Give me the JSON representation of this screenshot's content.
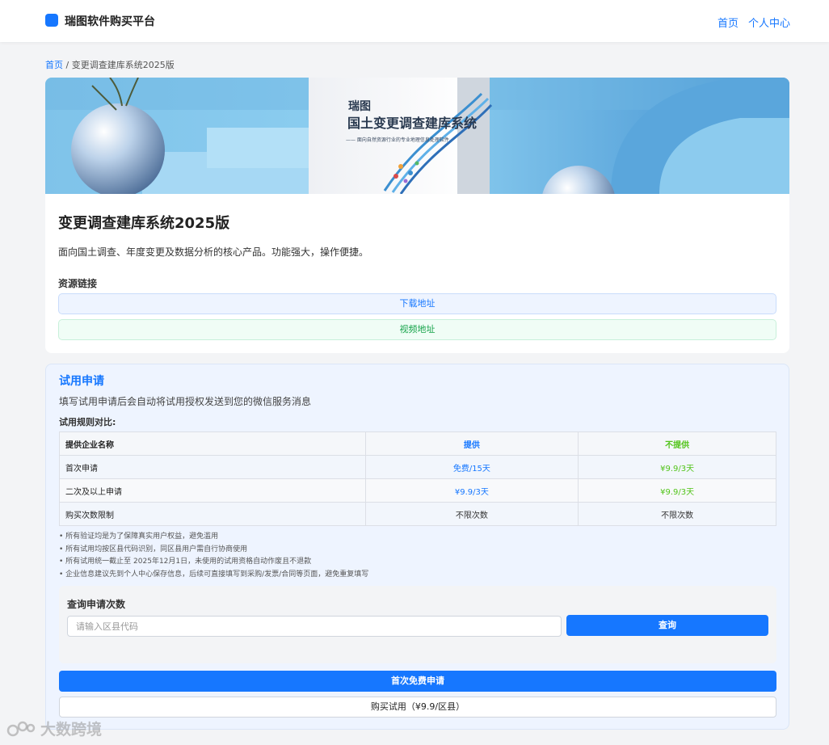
{
  "navbar": {
    "brand": "瑞图软件购买平台",
    "links": [
      {
        "label": "首页"
      },
      {
        "label": "个人中心"
      }
    ]
  },
  "breadcrumb": {
    "home": "首页",
    "separator": " / ",
    "current": "变更调查建库系统2025版"
  },
  "banner": {
    "box_brand": "瑞图",
    "box_title": "国土变更调查建库系统",
    "box_subtitle": "—— 面向自然资源行业的专业地理信息处理软件"
  },
  "product": {
    "title": "变更调查建库系统2025版",
    "description": "面向国土调查、年度变更及数据分析的核心产品。功能强大，操作便捷。",
    "resources_title": "资源链接",
    "download_label": "下载地址",
    "video_label": "视频地址"
  },
  "trial": {
    "title": "试用申请",
    "subtitle": "填写试用申请后会自动将试用授权发送到您的微信服务消息",
    "rules_title": "试用规则对比:",
    "table": {
      "headers": [
        "提供企业名称",
        "提供",
        "不提供"
      ],
      "rows": [
        [
          "首次申请",
          "免费/15天",
          "¥9.9/3天"
        ],
        [
          "二次及以上申请",
          "¥9.9/3天",
          "¥9.9/3天"
        ],
        [
          "购买次数限制",
          "不限次数",
          "不限次数"
        ]
      ]
    },
    "notes": [
      "所有验证均是为了保障真实用户权益，避免滥用",
      "所有试用均按区县代码识别，同区县用户需自行协商使用",
      "所有试用统一截止至 2025年12月1日，未使用的试用资格自动作废且不退款",
      "企业信息建议先到个人中心保存信息，后续可直接填写到采购/发票/合同等页面，避免重复填写"
    ],
    "query": {
      "title": "查询申请次数",
      "placeholder": "请输入区县代码",
      "button": "查询"
    },
    "apply_button": "首次免费申请",
    "buy_button": "购买试用（¥9.9/区县）"
  },
  "watermark": {
    "text": "大数跨境"
  },
  "colors": {
    "primary": "#1677ff",
    "success": "#52c41a",
    "page_bg": "#f3f4f6"
  }
}
